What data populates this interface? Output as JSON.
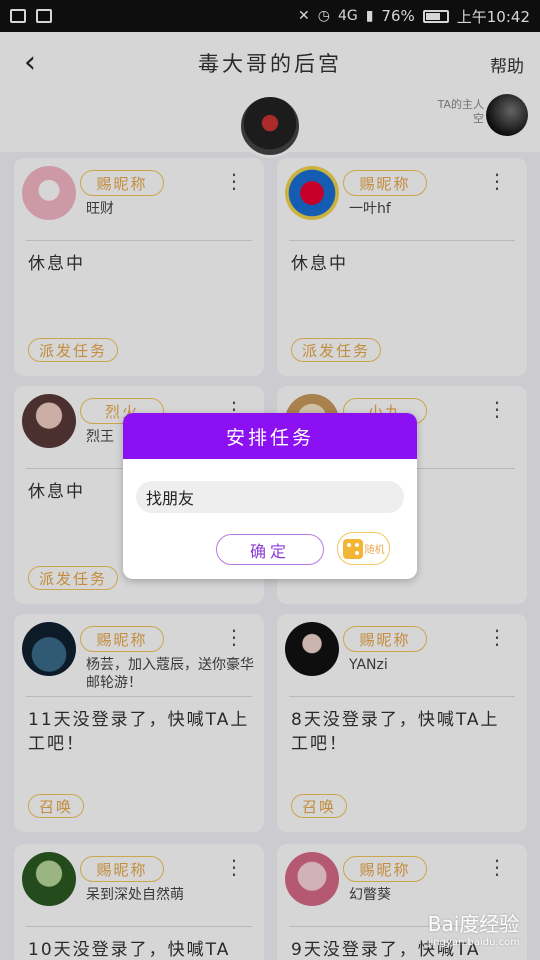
{
  "status_bar": {
    "battery": "76%",
    "time": "上午10:42",
    "network": "4G"
  },
  "app_bar": {
    "title": "毒大哥的后宫",
    "help": "帮助"
  },
  "owner": {
    "label": "TA的主人",
    "name": "空"
  },
  "cards": [
    {
      "nick_label": "赐昵称",
      "name": "旺财",
      "status": "休息中",
      "action": "派发任务"
    },
    {
      "nick_label": "赐昵称",
      "name": "一叶hf",
      "status": "休息中",
      "action": "派发任务"
    },
    {
      "nick_label": "烈火",
      "name": "烈王",
      "status": "休息中",
      "action": "派发任务"
    },
    {
      "nick_label": "小九",
      "name": "",
      "status": "",
      "action": ""
    },
    {
      "nick_label": "赐昵称",
      "name": "杨芸，加入蔻辰，送你豪华邮轮游！",
      "status": "11天没登录了，快喊TA上工吧！",
      "action": "召唤"
    },
    {
      "nick_label": "赐昵称",
      "name": "YANzi",
      "status": "8天没登录了，快喊TA上工吧！",
      "action": "召唤"
    },
    {
      "nick_label": "赐昵称",
      "name": "呆到深处自然萌",
      "status": "10天没登录了，快喊TA",
      "action": ""
    },
    {
      "nick_label": "赐昵称",
      "name": "幻瞥葵",
      "status": "9天没登录了，快喊TA",
      "action": ""
    }
  ],
  "dialog": {
    "title": "安排任务",
    "input_value": "找朋友",
    "confirm": "确定",
    "random": "随机"
  },
  "watermark": {
    "brand": "Bai度经验",
    "url": "jingyan.baidu.com"
  }
}
